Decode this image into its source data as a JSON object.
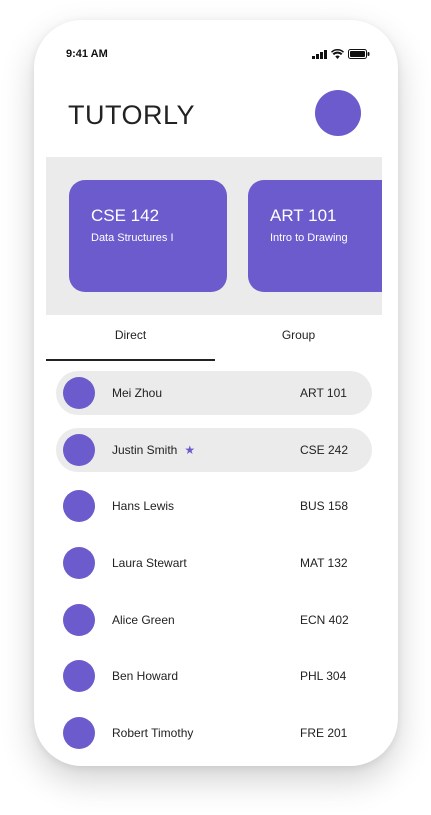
{
  "status_bar": {
    "time": "9:41 AM"
  },
  "header": {
    "brand": "TUTORLY"
  },
  "courses": [
    {
      "code": "CSE 142",
      "name": "Data Structures I"
    },
    {
      "code": "ART 101",
      "name": "Intro to Drawing"
    }
  ],
  "tabs": [
    {
      "label": "Direct",
      "selected": true
    },
    {
      "label": "Group",
      "selected": false
    }
  ],
  "contacts": [
    {
      "name": "Mei Zhou",
      "course": "ART 101",
      "highlighted": true,
      "starred": false
    },
    {
      "name": "Justin Smith",
      "course": "CSE 242",
      "highlighted": true,
      "starred": true
    },
    {
      "name": "Hans Lewis",
      "course": "BUS 158",
      "highlighted": false,
      "starred": false
    },
    {
      "name": "Laura Stewart",
      "course": "MAT 132",
      "highlighted": false,
      "starred": false
    },
    {
      "name": "Alice Green",
      "course": "ECN 402",
      "highlighted": false,
      "starred": false
    },
    {
      "name": "Ben Howard",
      "course": "PHL 304",
      "highlighted": false,
      "starred": false
    },
    {
      "name": "Robert Timothy",
      "course": "FRE 201",
      "highlighted": false,
      "starred": false
    }
  ],
  "colors": {
    "accent": "#6b5bcc",
    "strip_background": "#ebebeb",
    "text": "#222222"
  },
  "icons": {
    "signal": "signal-icon",
    "wifi": "wifi-icon",
    "battery": "battery-icon",
    "star": "star-icon"
  }
}
